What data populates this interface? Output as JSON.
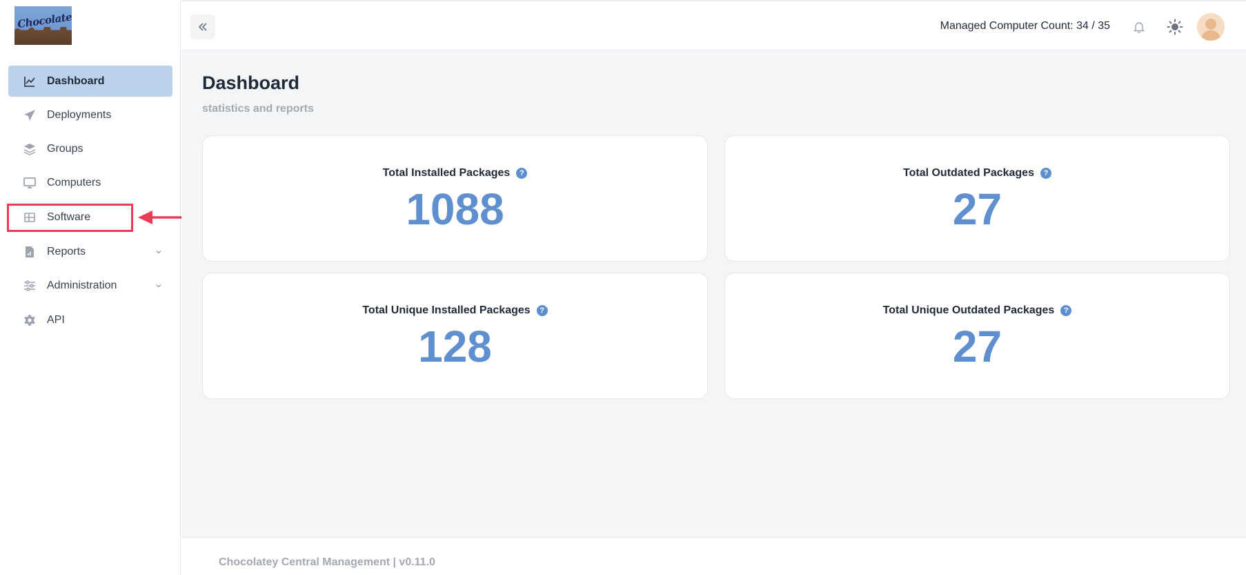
{
  "brand": {
    "logo_text": "Chocolatey"
  },
  "sidebar": {
    "items": [
      {
        "label": "Dashboard",
        "icon": "chart-line-icon",
        "active": true
      },
      {
        "label": "Deployments",
        "icon": "paper-plane-icon"
      },
      {
        "label": "Groups",
        "icon": "layers-icon"
      },
      {
        "label": "Computers",
        "icon": "monitor-icon"
      },
      {
        "label": "Software",
        "icon": "grid-icon"
      },
      {
        "label": "Reports",
        "icon": "file-chart-icon",
        "expandable": true
      },
      {
        "label": "Administration",
        "icon": "sliders-icon",
        "expandable": true
      },
      {
        "label": "API",
        "icon": "gear-icon"
      }
    ]
  },
  "header": {
    "managed_count": "Managed Computer Count: 34 / 35"
  },
  "page": {
    "title": "Dashboard",
    "subtitle": "statistics and reports"
  },
  "cards": [
    {
      "title": "Total Installed Packages",
      "value": "1088"
    },
    {
      "title": "Total Outdated Packages",
      "value": "27"
    },
    {
      "title": "Total Unique Installed Packages",
      "value": "128"
    },
    {
      "title": "Total Unique Outdated Packages",
      "value": "27"
    }
  ],
  "footer": {
    "text": "Chocolatey Central Management | v0.11.0"
  },
  "colors": {
    "accent": "#5f8fcf",
    "active_nav": "#bcd2ec",
    "annotation": "#ef3a56"
  }
}
